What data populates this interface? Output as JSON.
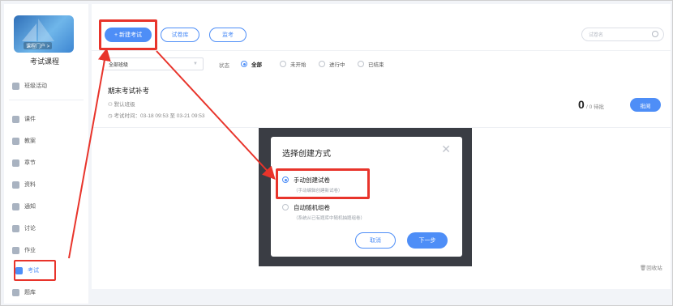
{
  "sidebar": {
    "cover_tag": "课程门户 >",
    "course_name": "考试课程",
    "items": [
      {
        "label": "班级活动",
        "icon": "grid-icon"
      },
      {
        "label": "课件",
        "icon": "courseware-icon"
      },
      {
        "label": "教案",
        "icon": "lesson-plan-icon"
      },
      {
        "label": "章节",
        "icon": "chapter-icon"
      },
      {
        "label": "资料",
        "icon": "folder-icon"
      },
      {
        "label": "通知",
        "icon": "megaphone-icon"
      },
      {
        "label": "讨论",
        "icon": "chat-icon"
      },
      {
        "label": "作业",
        "icon": "homework-icon"
      },
      {
        "label": "考试",
        "icon": "exam-icon"
      },
      {
        "label": "题库",
        "icon": "question-bank-icon"
      }
    ]
  },
  "toolbar": {
    "new_exam": "+ 新建考试",
    "paper_bank": "试卷库",
    "proctor": "监考",
    "search_placeholder": "试卷名"
  },
  "filter": {
    "class_select": "全部班级",
    "status_label": "状态",
    "statuses": [
      {
        "label": "全部",
        "selected": true
      },
      {
        "label": "未开始",
        "selected": false
      },
      {
        "label": "进行中",
        "selected": false
      },
      {
        "label": "已结束",
        "selected": false
      }
    ]
  },
  "exam": {
    "title": "期末考试补考",
    "class": "默认班级",
    "time": "考试时间：03-18 09:53 至 03-21 09:53",
    "score_big": "0",
    "score_rest": "/ 0  待批",
    "review_label": "批阅"
  },
  "recycle": "回收站",
  "modal": {
    "title": "选择创建方式",
    "option_manual": "手动创建试卷",
    "option_manual_hint": "（手动编辑创建新试卷）",
    "option_random": "自动随机组卷",
    "option_random_hint": "（系统从已有题库中随机抽题组卷）",
    "cancel": "取消",
    "next": "下一步"
  },
  "colors": {
    "accent": "#4e8ef7",
    "annotation": "#e8342b"
  }
}
